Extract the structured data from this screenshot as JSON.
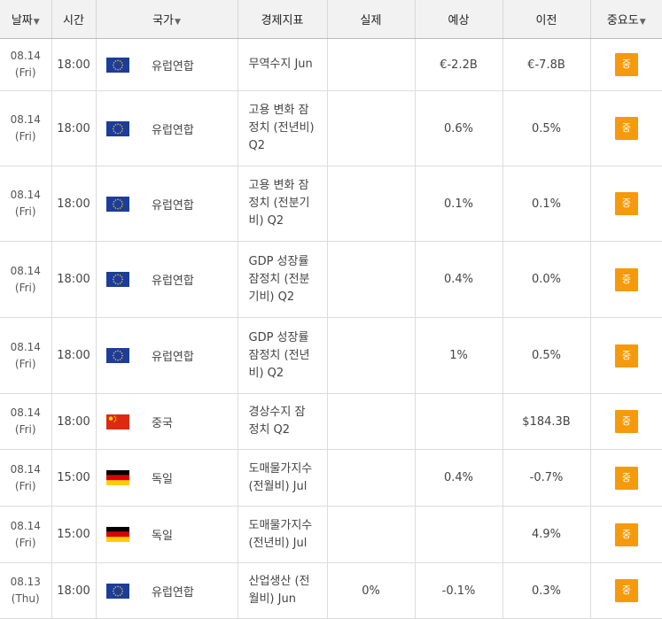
{
  "headers": {
    "date": "날짜",
    "time": "시간",
    "country": "국가",
    "indicator": "경제지표",
    "actual": "실제",
    "forecast": "예상",
    "previous": "이전",
    "importance": "중요도",
    "sort_icon": "sort-down-triangle-icon"
  },
  "flag_colors": {
    "eu": [
      "#1c3d99",
      "#ffcc00"
    ],
    "cn": [
      "#de2910",
      "#ffde00"
    ],
    "de": [
      "#000000",
      "#dd0000",
      "#ffce00"
    ]
  },
  "badge_color": "#f59a0c",
  "rows": [
    {
      "date": "08.14",
      "day": "(Fri)",
      "time": "18:00",
      "flag": "eu",
      "country": "유럽연합",
      "indicator": [
        "무역수지 Jun"
      ],
      "actual": "",
      "forecast": "€-2.2B",
      "previous": "€-7.8B",
      "importance": "중"
    },
    {
      "date": "08.14",
      "day": "(Fri)",
      "time": "18:00",
      "flag": "eu",
      "country": "유럽연합",
      "indicator": [
        "고용 변화 잠",
        "정치 (전년비)",
        "Q2"
      ],
      "actual": "",
      "forecast": "0.6%",
      "previous": "0.5%",
      "importance": "중"
    },
    {
      "date": "08.14",
      "day": "(Fri)",
      "time": "18:00",
      "flag": "eu",
      "country": "유럽연합",
      "indicator": [
        "고용 변화 잠",
        "정치 (전분기",
        "비) Q2"
      ],
      "actual": "",
      "forecast": "0.1%",
      "previous": "0.1%",
      "importance": "중"
    },
    {
      "date": "08.14",
      "day": "(Fri)",
      "time": "18:00",
      "flag": "eu",
      "country": "유럽연합",
      "indicator": [
        "GDP 성장률",
        "잠정치 (전분",
        "기비) Q2"
      ],
      "actual": "",
      "forecast": "0.4%",
      "previous": "0.0%",
      "importance": "중"
    },
    {
      "date": "08.14",
      "day": "(Fri)",
      "time": "18:00",
      "flag": "eu",
      "country": "유럽연합",
      "indicator": [
        "GDP 성장률",
        "잠정치 (전년",
        "비) Q2"
      ],
      "actual": "",
      "forecast": "1%",
      "previous": "0.5%",
      "importance": "중"
    },
    {
      "date": "08.14",
      "day": "(Fri)",
      "time": "18:00",
      "flag": "cn",
      "country": "중국",
      "indicator": [
        "경상수지 잠",
        "정치 Q2"
      ],
      "actual": "",
      "forecast": "",
      "previous": "$184.3B",
      "importance": "중"
    },
    {
      "date": "08.14",
      "day": "(Fri)",
      "time": "15:00",
      "flag": "de",
      "country": "독일",
      "indicator": [
        "도매물가지수",
        "(전월비) Jul"
      ],
      "actual": "",
      "forecast": "0.4%",
      "previous": "-0.7%",
      "importance": "중"
    },
    {
      "date": "08.14",
      "day": "(Fri)",
      "time": "15:00",
      "flag": "de",
      "country": "독일",
      "indicator": [
        "도매물가지수",
        "(전년비) Jul"
      ],
      "actual": "",
      "forecast": "",
      "previous": "4.9%",
      "importance": "중"
    },
    {
      "date": "08.13",
      "day": "(Thu)",
      "time": "18:00",
      "flag": "eu",
      "country": "유럽연합",
      "indicator": [
        "산업생산 (전",
        "월비) Jun"
      ],
      "actual": "0%",
      "forecast": "-0.1%",
      "previous": "0.3%",
      "importance": "중"
    }
  ]
}
